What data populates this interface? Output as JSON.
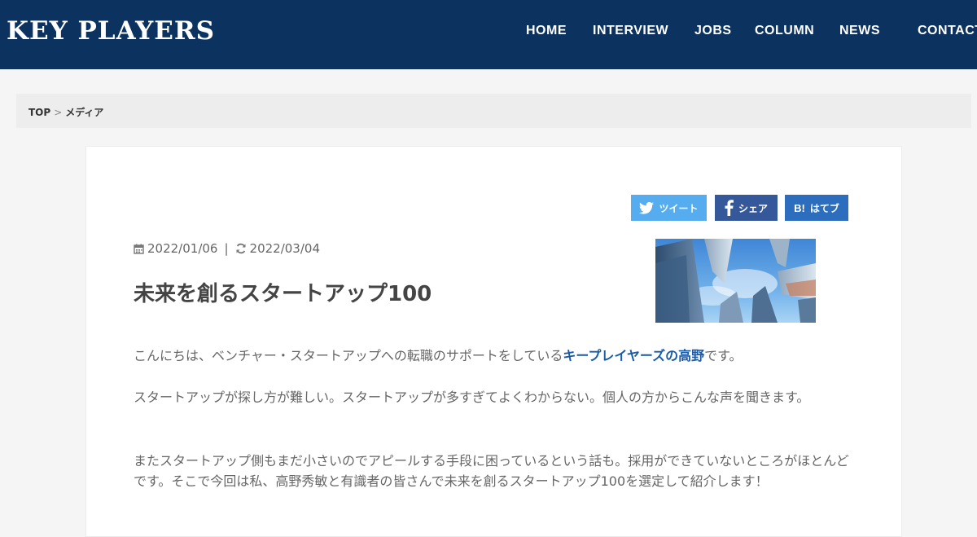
{
  "header": {
    "logo": "KEY PLAYERS",
    "nav": [
      "HOME",
      "INTERVIEW",
      "JOBS",
      "COLUMN",
      "NEWS",
      "CONTACT"
    ]
  },
  "breadcrumb": {
    "top": "TOP",
    "separator": ">",
    "current": "メディア"
  },
  "share": {
    "twitter": "ツイート",
    "facebook": "シェア",
    "hatena": "はてブ",
    "hatena_icon": "B!"
  },
  "article": {
    "published": "2022/01/06",
    "updated": "2022/03/04",
    "separator": "|",
    "title": "未来を創るスタートアップ100",
    "p1_before": "こんにちは、ベンチャー・スタートアップへの転職のサポートをしている",
    "p1_highlight": "キープレイヤーズの高野",
    "p1_after": "です。",
    "p2": "スタートアップが探し方が難しい。スタートアップが多すぎてよくわからない。個人の方からこんな声を聞きます。",
    "p3": "またスタートアップ側もまだ小さいのでアピールする手段に困っているという話も。採用ができていないところがほとんどです。そこで今回は私、高野秀敏と有識者の皆さんで未来を創るスタートアップ100を選定して紹介します！"
  },
  "colors": {
    "header_bg": "#0c3260",
    "twitter": "#55acee",
    "facebook": "#35589a",
    "hatena": "#2c6ebd",
    "link": "#1a5ba8"
  }
}
